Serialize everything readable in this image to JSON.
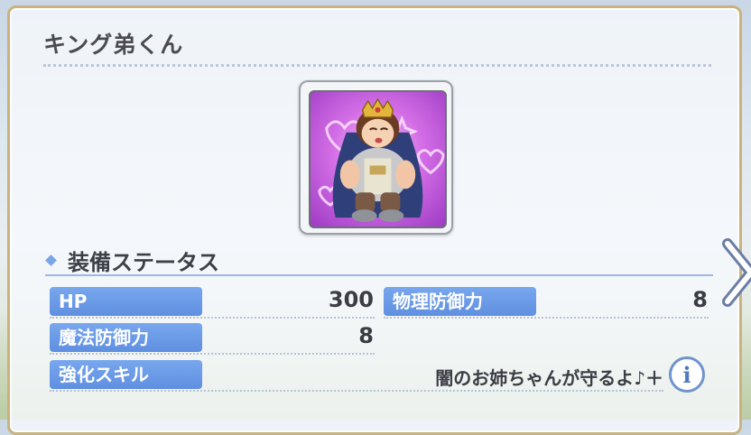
{
  "header": {
    "title": "キング弟くん"
  },
  "character": {
    "portrait_icon": "king-little-brother-portrait"
  },
  "equipment": {
    "section_title": "装備ステータス",
    "stats": [
      {
        "label": "HP",
        "value": "300"
      },
      {
        "label": "物理防御力",
        "value": "8"
      },
      {
        "label": "魔法防御力",
        "value": "8"
      }
    ],
    "skill": {
      "label": "強化スキル",
      "value": "闇のお姉ちゃんが守るよ♪＋"
    }
  },
  "buttons": {
    "info_symbol": "i"
  },
  "icons": {
    "next": "chevron-right-icon",
    "info": "info-icon"
  },
  "colors": {
    "label_blue": "#6a9be8",
    "frame_gold": "#c9b27e",
    "text_dark": "#3c3c44"
  }
}
